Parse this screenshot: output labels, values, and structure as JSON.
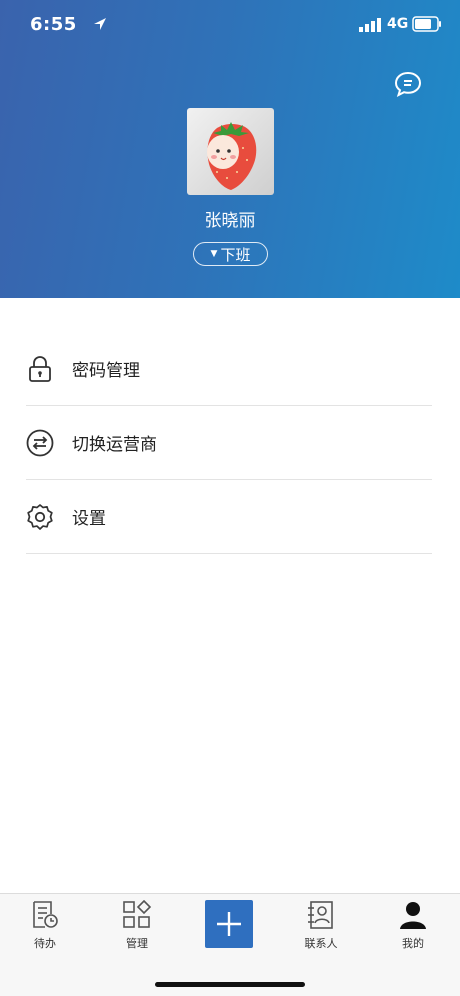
{
  "status_bar": {
    "time": "6:55",
    "network": "4G"
  },
  "profile": {
    "name": "张晓丽",
    "status": "下班"
  },
  "menu": [
    {
      "label": "密码管理",
      "icon": "lock-icon"
    },
    {
      "label": "切换运营商",
      "icon": "swap-icon"
    },
    {
      "label": "设置",
      "icon": "gear-icon"
    }
  ],
  "tabbar": {
    "items": [
      {
        "label": "待办",
        "icon": "todo-icon"
      },
      {
        "label": "管理",
        "icon": "manage-icon"
      },
      {
        "label": "",
        "icon": "plus-icon"
      },
      {
        "label": "联系人",
        "icon": "contacts-icon"
      },
      {
        "label": "我的",
        "icon": "profile-icon"
      }
    ]
  },
  "colors": {
    "header_start": "#3a63ad",
    "header_end": "#1e8bc9",
    "accent": "#2f6fbf"
  }
}
